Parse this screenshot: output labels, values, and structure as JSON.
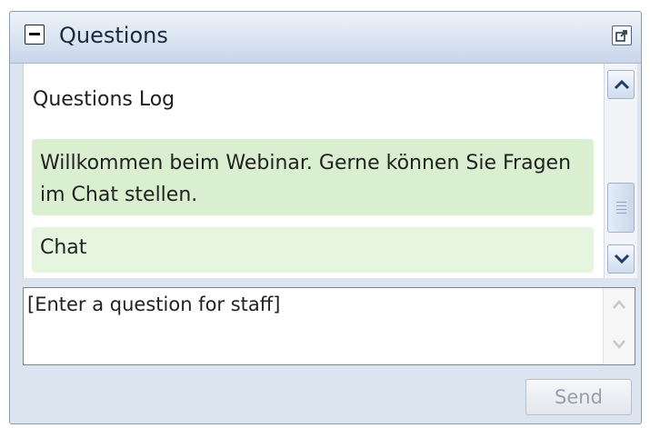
{
  "panel": {
    "title": "Questions",
    "collapse_icon": "minus-icon",
    "popout_icon": "popout-icon"
  },
  "log": {
    "heading": "Questions Log",
    "welcome_message": "Willkommen beim Webinar. Gerne können Sie Fragen im Chat stellen.",
    "chat_label": "Chat"
  },
  "input": {
    "placeholder": "[Enter a question for staff]",
    "value": ""
  },
  "send": {
    "label": "Send",
    "enabled": false
  },
  "colors": {
    "message_bg": "#d9efcf",
    "chat_bg": "#e6f5df",
    "titlebar": "#dbe5f2"
  }
}
